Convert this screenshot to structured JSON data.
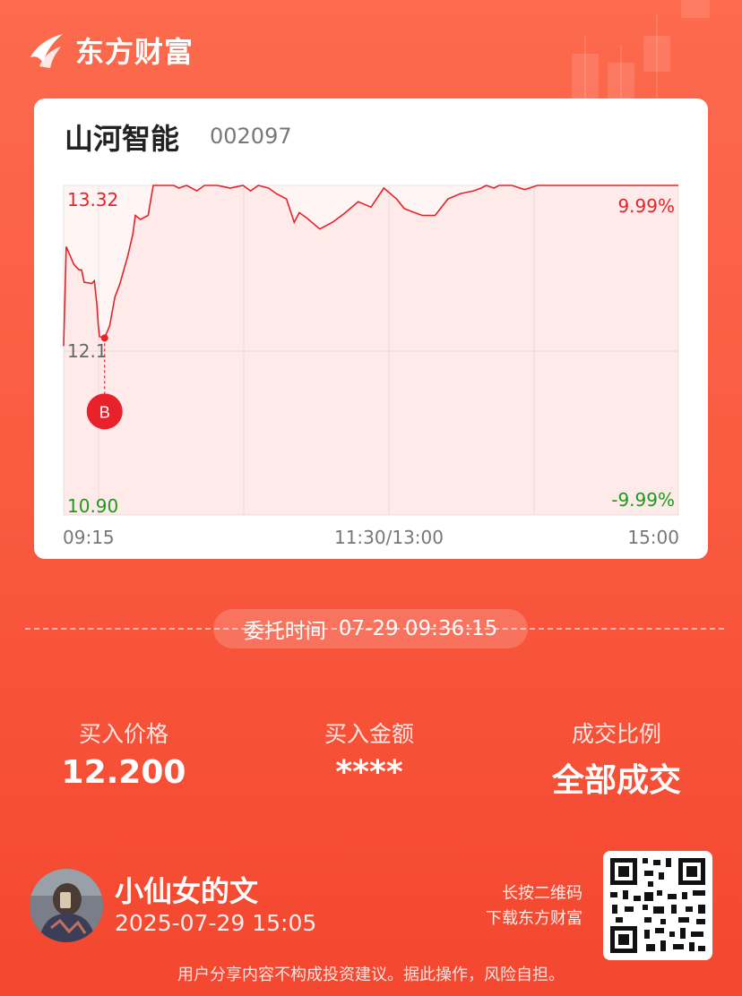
{
  "brand": {
    "name": "东方财富"
  },
  "stock": {
    "name": "山河智能",
    "code": "002097"
  },
  "chart_data": {
    "type": "line",
    "y_top_label": "13.32",
    "y_mid_label": "12.1",
    "y_bottom_label": "10.90",
    "pct_top_label": "9.99%",
    "pct_bottom_label": "-9.99%",
    "x_labels": [
      "09:15",
      "11:30/13:00",
      "15:00"
    ],
    "ylim": [
      10.9,
      13.32
    ],
    "prev_close": 12.11,
    "series": [
      {
        "x": [
          0,
          1,
          4,
          6,
          7,
          8,
          11,
          12,
          13,
          13.5,
          14,
          16,
          18,
          20,
          22,
          25,
          27,
          28,
          30,
          33,
          35,
          38,
          40,
          43,
          45,
          48,
          52,
          55,
          57,
          60,
          65,
          70,
          73,
          76,
          80,
          83,
          87,
          90,
          92,
          95,
          100,
          105,
          110,
          115,
          120,
          125,
          130,
          133,
          137,
          140,
          145,
          150,
          155,
          160,
          163,
          165,
          168,
          170,
          175,
          180,
          185,
          190,
          195,
          200,
          205,
          210,
          215,
          220,
          225,
          230,
          235,
          240
        ],
        "y": [
          12.14,
          12.87,
          12.74,
          12.7,
          12.7,
          12.61,
          12.6,
          12.62,
          12.44,
          12.3,
          12.21,
          12.2,
          12.29,
          12.5,
          12.6,
          12.8,
          12.96,
          13.1,
          13.07,
          13.1,
          13.32,
          13.32,
          13.32,
          13.32,
          13.3,
          13.32,
          13.28,
          13.32,
          13.32,
          13.32,
          13.3,
          13.32,
          13.28,
          13.32,
          13.3,
          13.26,
          13.22,
          13.05,
          13.12,
          13.08,
          13.0,
          13.05,
          13.12,
          13.2,
          13.16,
          13.3,
          13.22,
          13.15,
          13.12,
          13.1,
          13.1,
          13.22,
          13.26,
          13.28,
          13.3,
          13.32,
          13.3,
          13.32,
          13.32,
          13.29,
          13.32,
          13.32,
          13.32,
          13.32,
          13.32,
          13.32,
          13.32,
          13.32,
          13.32,
          13.32,
          13.32,
          13.32
        ]
      }
    ],
    "buy_marker": {
      "label": "B",
      "x": 16,
      "y": 12.2
    }
  },
  "order": {
    "label": "委托时间",
    "value": "07-29 09:36:15"
  },
  "stats": [
    {
      "label": "买入价格",
      "value": "12.200"
    },
    {
      "label": "买入金额",
      "value": "****"
    },
    {
      "label": "成交比例",
      "value": "全部成交"
    }
  ],
  "user": {
    "name": "小仙女的文",
    "time": "2025-07-29 15:05"
  },
  "qr": {
    "hint_line1": "长按二维码",
    "hint_line2": "下载东方财富"
  },
  "disclaimer": "用户分享内容不构成投资建议。据此操作，风险自担。",
  "colors": {
    "up": "#e8212a",
    "down": "#1d9a1d",
    "bg": "#f95a40"
  }
}
